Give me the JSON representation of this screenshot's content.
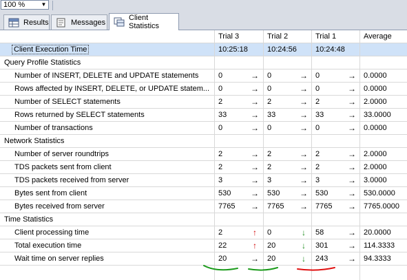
{
  "zoom": {
    "value": "100 %"
  },
  "tabs": [
    {
      "label": "Results",
      "icon": "grid-icon"
    },
    {
      "label": "Messages",
      "icon": "messages-icon"
    },
    {
      "label": "Client Statistics",
      "icon": "statistics-icon",
      "active": true
    }
  ],
  "columns": [
    "",
    "Trial 3",
    "Trial 2",
    "Trial 1",
    "Average"
  ],
  "rows": [
    {
      "type": "exec",
      "label": "Client Execution Time",
      "t3": "10:25:18",
      "a1": "",
      "t2": "10:24:56",
      "a2": "",
      "t1": "10:24:48",
      "a3": "",
      "avg": ""
    },
    {
      "type": "section",
      "label": "Query Profile Statistics"
    },
    {
      "type": "data",
      "label": "Number of INSERT, DELETE and UPDATE statements",
      "t3": "0",
      "a1": "right",
      "t2": "0",
      "a2": "right",
      "t1": "0",
      "a3": "right",
      "avg": "0.0000"
    },
    {
      "type": "data",
      "label": "Rows affected by INSERT, DELETE, or UPDATE statem...",
      "t3": "0",
      "a1": "right",
      "t2": "0",
      "a2": "right",
      "t1": "0",
      "a3": "right",
      "avg": "0.0000"
    },
    {
      "type": "data",
      "label": "Number of SELECT statements",
      "t3": "2",
      "a1": "right",
      "t2": "2",
      "a2": "right",
      "t1": "2",
      "a3": "right",
      "avg": "2.0000"
    },
    {
      "type": "data",
      "label": "Rows returned by SELECT statements",
      "t3": "33",
      "a1": "right",
      "t2": "33",
      "a2": "right",
      "t1": "33",
      "a3": "right",
      "avg": "33.0000"
    },
    {
      "type": "data",
      "label": "Number of transactions",
      "t3": "0",
      "a1": "right",
      "t2": "0",
      "a2": "right",
      "t1": "0",
      "a3": "right",
      "avg": "0.0000"
    },
    {
      "type": "section",
      "label": "Network Statistics"
    },
    {
      "type": "data",
      "label": "Number of server roundtrips",
      "t3": "2",
      "a1": "right",
      "t2": "2",
      "a2": "right",
      "t1": "2",
      "a3": "right",
      "avg": "2.0000"
    },
    {
      "type": "data",
      "label": "TDS packets sent from client",
      "t3": "2",
      "a1": "right",
      "t2": "2",
      "a2": "right",
      "t1": "2",
      "a3": "right",
      "avg": "2.0000"
    },
    {
      "type": "data",
      "label": "TDS packets received from server",
      "t3": "3",
      "a1": "right",
      "t2": "3",
      "a2": "right",
      "t1": "3",
      "a3": "right",
      "avg": "3.0000"
    },
    {
      "type": "data",
      "label": "Bytes sent from client",
      "t3": "530",
      "a1": "right",
      "t2": "530",
      "a2": "right",
      "t1": "530",
      "a3": "right",
      "avg": "530.0000"
    },
    {
      "type": "data",
      "label": "Bytes received from server",
      "t3": "7765",
      "a1": "right",
      "t2": "7765",
      "a2": "right",
      "t1": "7765",
      "a3": "right",
      "avg": "7765.0000"
    },
    {
      "type": "section",
      "label": "Time Statistics"
    },
    {
      "type": "data",
      "label": "Client processing time",
      "t3": "2",
      "a1": "up",
      "t2": "0",
      "a2": "down",
      "t1": "58",
      "a3": "right",
      "avg": "20.0000"
    },
    {
      "type": "data",
      "label": "Total execution time",
      "t3": "22",
      "a1": "up",
      "t2": "20",
      "a2": "down",
      "t1": "301",
      "a3": "right",
      "avg": "114.3333"
    },
    {
      "type": "data",
      "label": "Wait time on server replies",
      "t3": "20",
      "a1": "right",
      "t2": "20",
      "a2": "down",
      "t1": "243",
      "a3": "right",
      "avg": "94.3333"
    }
  ],
  "annotation_colors": {
    "trial3": "#1a9a1a",
    "trial2": "#1a9a1a",
    "trial1": "#e01010"
  },
  "colors": {
    "selected_row": "#cfe2f8",
    "toolbar": "#d9dde5",
    "arrow_up": "#d00000",
    "arrow_down": "#1a8a1a"
  }
}
